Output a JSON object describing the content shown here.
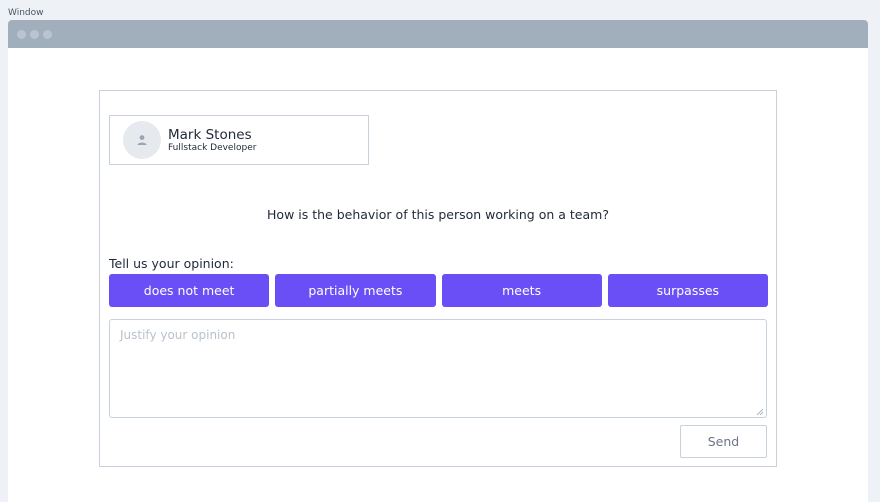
{
  "window": {
    "caption": "Window"
  },
  "profile": {
    "name": "Mark Stones",
    "role": "Fullstack Developer",
    "avatar_icon": "user-icon"
  },
  "question": "How is the behavior of this person working on a team?",
  "opinion": {
    "label": "Tell us your opinion:",
    "choices": [
      "does not meet",
      "partially meets",
      "meets",
      "surpasses"
    ],
    "choice_color": "#6a4ff6"
  },
  "justify": {
    "placeholder": "Justify your opinion",
    "value": ""
  },
  "send_label": "Send"
}
